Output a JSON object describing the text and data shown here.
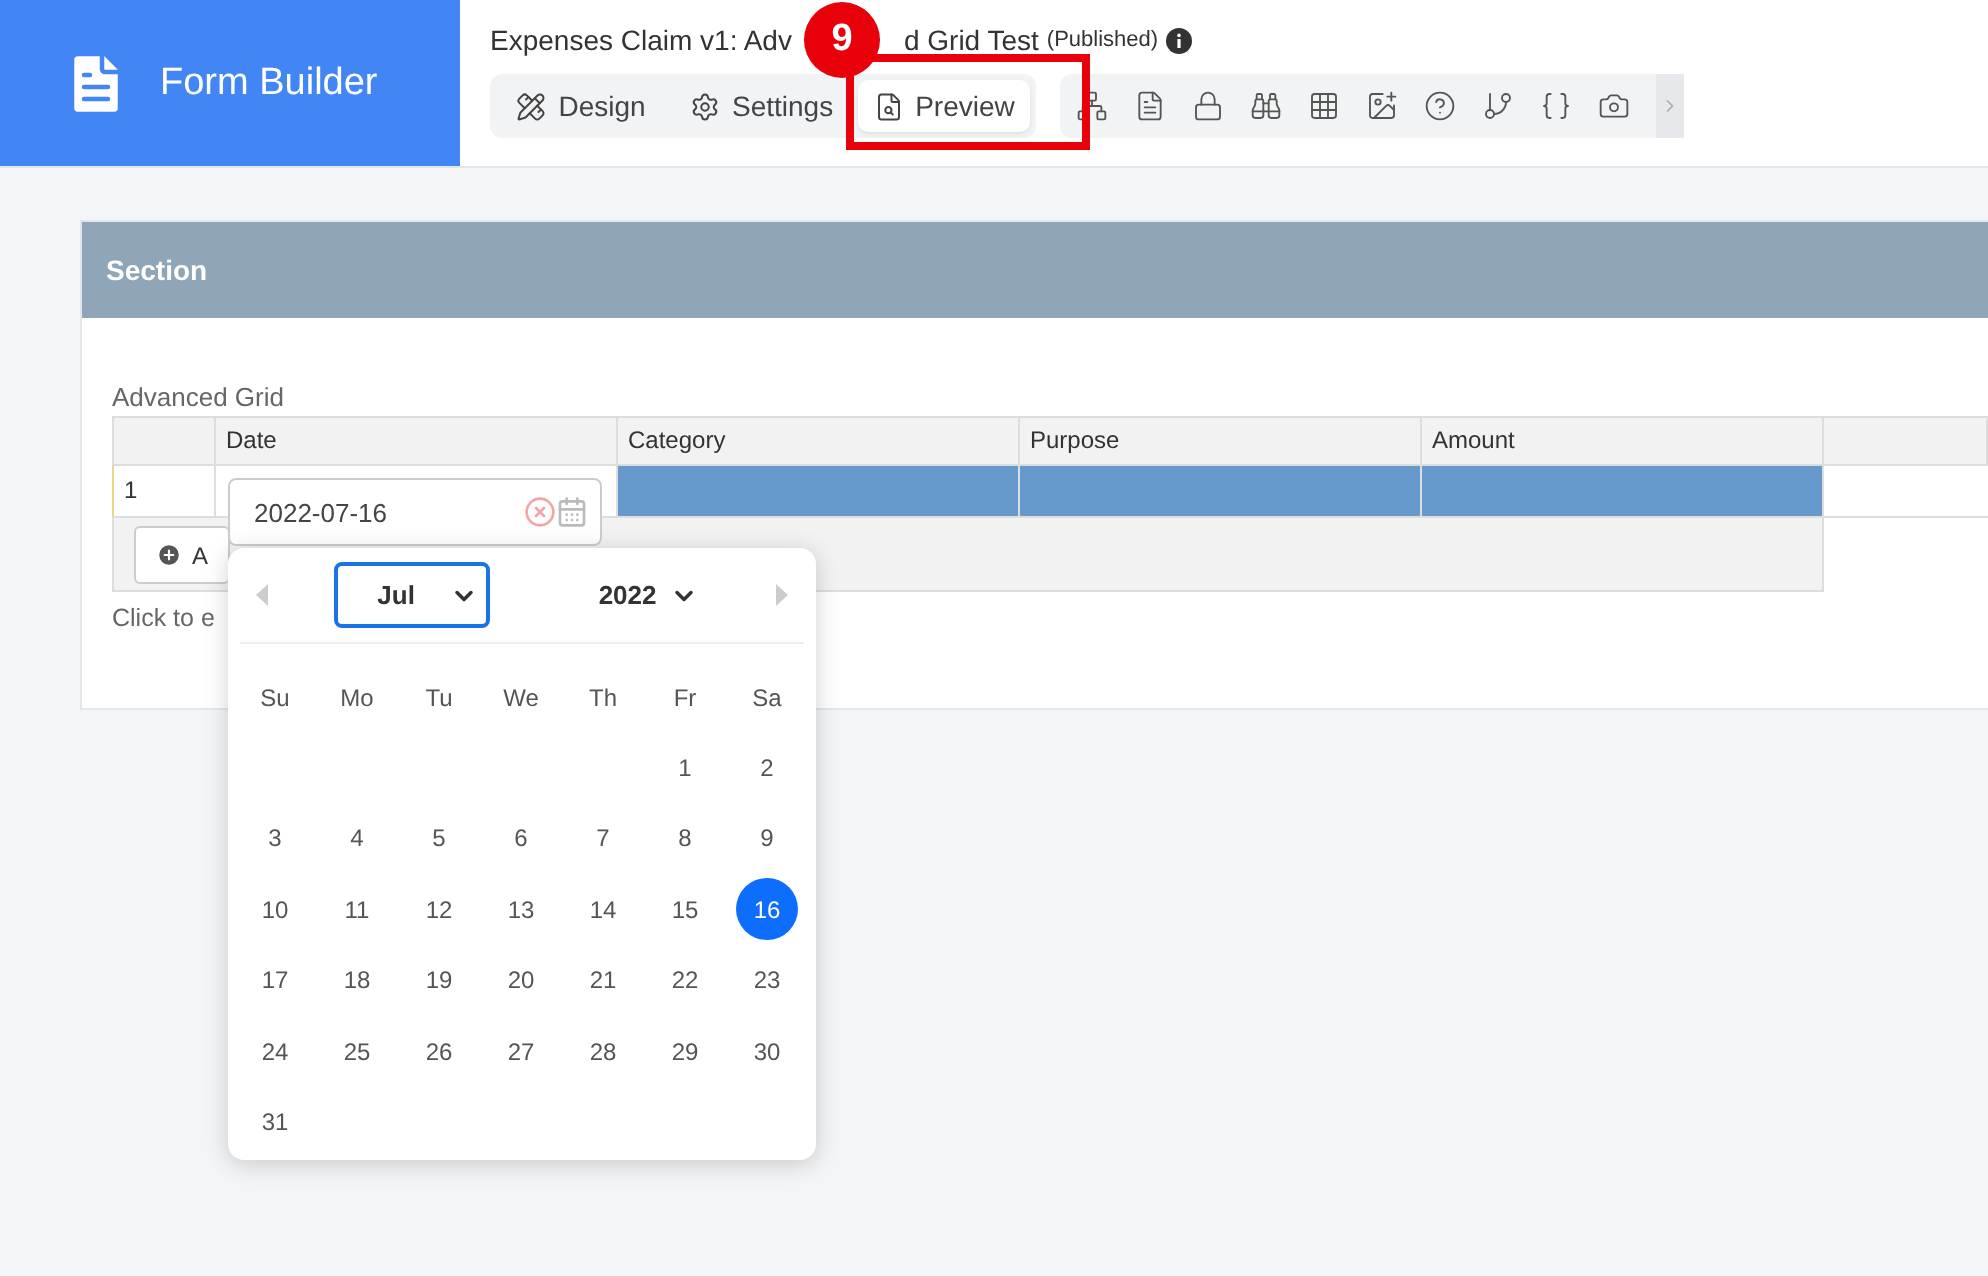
{
  "brand": {
    "title": "Form Builder"
  },
  "form_title": {
    "parts": [
      "Expenses Claim v1: Adv",
      "d Grid Test"
    ],
    "status": "(Published)"
  },
  "tabs": [
    {
      "label": "Design",
      "selected": false
    },
    {
      "label": "Settings",
      "selected": false
    },
    {
      "label": "Preview",
      "selected": true
    }
  ],
  "callout": {
    "number": "9"
  },
  "section": {
    "title": "Section"
  },
  "grid": {
    "label": "Advanced Grid",
    "columns": [
      "Date",
      "Category",
      "Purpose",
      "Amount"
    ],
    "rows": [
      {
        "number": "1",
        "date": "2022-07-16"
      }
    ],
    "add_button": "A",
    "hint": "Click to e"
  },
  "datepicker": {
    "month": "Jul",
    "year": "2022",
    "weekdays": [
      "Su",
      "Mo",
      "Tu",
      "We",
      "Th",
      "Fr",
      "Sa"
    ],
    "weeks": [
      [
        {
          "day": "1",
          "selected": false
        },
        {
          "day": "2",
          "selected": false
        }
      ],
      [
        {
          "day": "3",
          "selected": false
        },
        {
          "day": "4",
          "selected": false
        },
        {
          "day": "5",
          "selected": false
        },
        {
          "day": "6",
          "selected": false
        },
        {
          "day": "7",
          "selected": false
        },
        {
          "day": "8",
          "selected": false
        },
        {
          "day": "9",
          "selected": false
        }
      ],
      [
        {
          "day": "10",
          "selected": false
        },
        {
          "day": "11",
          "selected": false
        },
        {
          "day": "12",
          "selected": false
        },
        {
          "day": "13",
          "selected": false
        },
        {
          "day": "14",
          "selected": false
        },
        {
          "day": "15",
          "selected": false
        },
        {
          "day": "16",
          "selected": true
        }
      ],
      [
        {
          "day": "17",
          "selected": false
        },
        {
          "day": "18",
          "selected": false
        },
        {
          "day": "19",
          "selected": false
        },
        {
          "day": "20",
          "selected": false
        },
        {
          "day": "21",
          "selected": false
        },
        {
          "day": "22",
          "selected": false
        },
        {
          "day": "23",
          "selected": false
        }
      ],
      [
        {
          "day": "24",
          "selected": false
        },
        {
          "day": "25",
          "selected": false
        },
        {
          "day": "26",
          "selected": false
        },
        {
          "day": "27",
          "selected": false
        },
        {
          "day": "28",
          "selected": false
        },
        {
          "day": "29",
          "selected": false
        },
        {
          "day": "30",
          "selected": false
        }
      ],
      [
        {
          "day": "31",
          "selected": false
        }
      ]
    ]
  }
}
